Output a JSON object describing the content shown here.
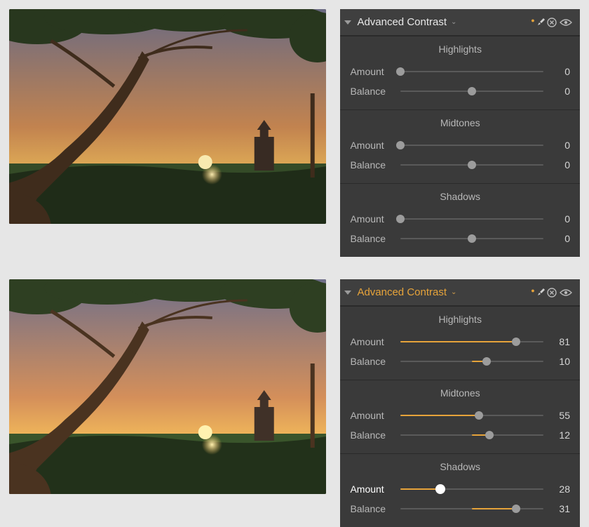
{
  "panels": [
    {
      "title": "Advanced Contrast",
      "active": false,
      "groups": [
        {
          "name": "Highlights",
          "sliders": [
            {
              "label": "Amount",
              "value": 0,
              "min": 0,
              "max": 100,
              "center": false,
              "hot": false
            },
            {
              "label": "Balance",
              "value": 0,
              "min": -50,
              "max": 50,
              "center": true,
              "hot": false
            }
          ]
        },
        {
          "name": "Midtones",
          "sliders": [
            {
              "label": "Amount",
              "value": 0,
              "min": 0,
              "max": 100,
              "center": false,
              "hot": false
            },
            {
              "label": "Balance",
              "value": 0,
              "min": -50,
              "max": 50,
              "center": true,
              "hot": false
            }
          ]
        },
        {
          "name": "Shadows",
          "sliders": [
            {
              "label": "Amount",
              "value": 0,
              "min": 0,
              "max": 100,
              "center": false,
              "hot": false
            },
            {
              "label": "Balance",
              "value": 0,
              "min": -50,
              "max": 50,
              "center": true,
              "hot": false
            }
          ]
        }
      ]
    },
    {
      "title": "Advanced Contrast",
      "active": true,
      "groups": [
        {
          "name": "Highlights",
          "sliders": [
            {
              "label": "Amount",
              "value": 81,
              "min": 0,
              "max": 100,
              "center": false,
              "hot": false
            },
            {
              "label": "Balance",
              "value": 10,
              "min": -50,
              "max": 50,
              "center": true,
              "hot": false
            }
          ]
        },
        {
          "name": "Midtones",
          "sliders": [
            {
              "label": "Amount",
              "value": 55,
              "min": 0,
              "max": 100,
              "center": false,
              "hot": false
            },
            {
              "label": "Balance",
              "value": 12,
              "min": -50,
              "max": 50,
              "center": true,
              "hot": false
            }
          ]
        },
        {
          "name": "Shadows",
          "sliders": [
            {
              "label": "Amount",
              "value": 28,
              "min": 0,
              "max": 100,
              "center": false,
              "hot": true
            },
            {
              "label": "Balance",
              "value": 31,
              "min": -50,
              "max": 50,
              "center": true,
              "hot": false
            }
          ]
        }
      ]
    }
  ]
}
